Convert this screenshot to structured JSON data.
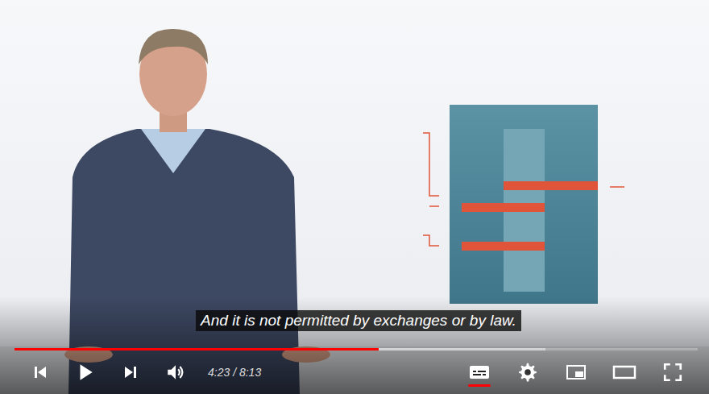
{
  "player": {
    "caption": {
      "text": "And it is not permitted by exchanges or by law.",
      "on": true
    },
    "progress": {
      "played": 0.533,
      "buffered": 0.777
    },
    "time": "4:23 / 8:13",
    "playing": false
  }
}
